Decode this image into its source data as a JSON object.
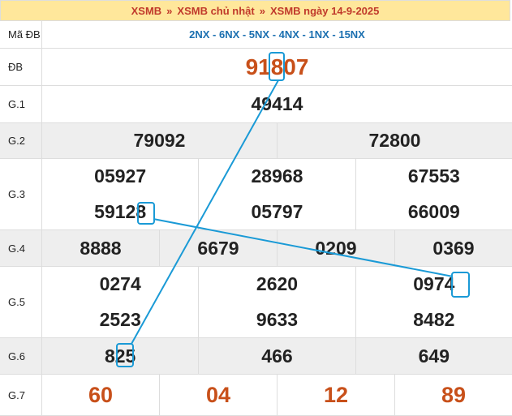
{
  "header": {
    "crumb1": "XSMB",
    "crumb2": "XSMB chủ nhật",
    "crumb3": "XSMB ngày 14-9-2025",
    "sep": "»"
  },
  "codes_label": "Mã ĐB",
  "codes": "2NX - 6NX - 5NX - 4NX - 1NX - 15NX",
  "prizes": {
    "db": {
      "label": "ĐB",
      "values": [
        "91807"
      ]
    },
    "g1": {
      "label": "G.1",
      "values": [
        "49414"
      ]
    },
    "g2": {
      "label": "G.2",
      "values": [
        "79092",
        "72800"
      ]
    },
    "g3": {
      "label": "G.3",
      "values": [
        "05927",
        "28968",
        "67553",
        "59128",
        "05797",
        "66009"
      ]
    },
    "g4": {
      "label": "G.4",
      "values": [
        "8888",
        "6679",
        "0209",
        "0369"
      ]
    },
    "g5": {
      "label": "G.5",
      "values": [
        "0274",
        "2620",
        "0974",
        "2523",
        "9633",
        "8482"
      ]
    },
    "g6": {
      "label": "G.6",
      "values": [
        "825",
        "466",
        "649"
      ]
    },
    "g7": {
      "label": "G.7",
      "values": [
        "60",
        "04",
        "12",
        "89"
      ]
    }
  },
  "highlight_color": "#1a9ad6"
}
